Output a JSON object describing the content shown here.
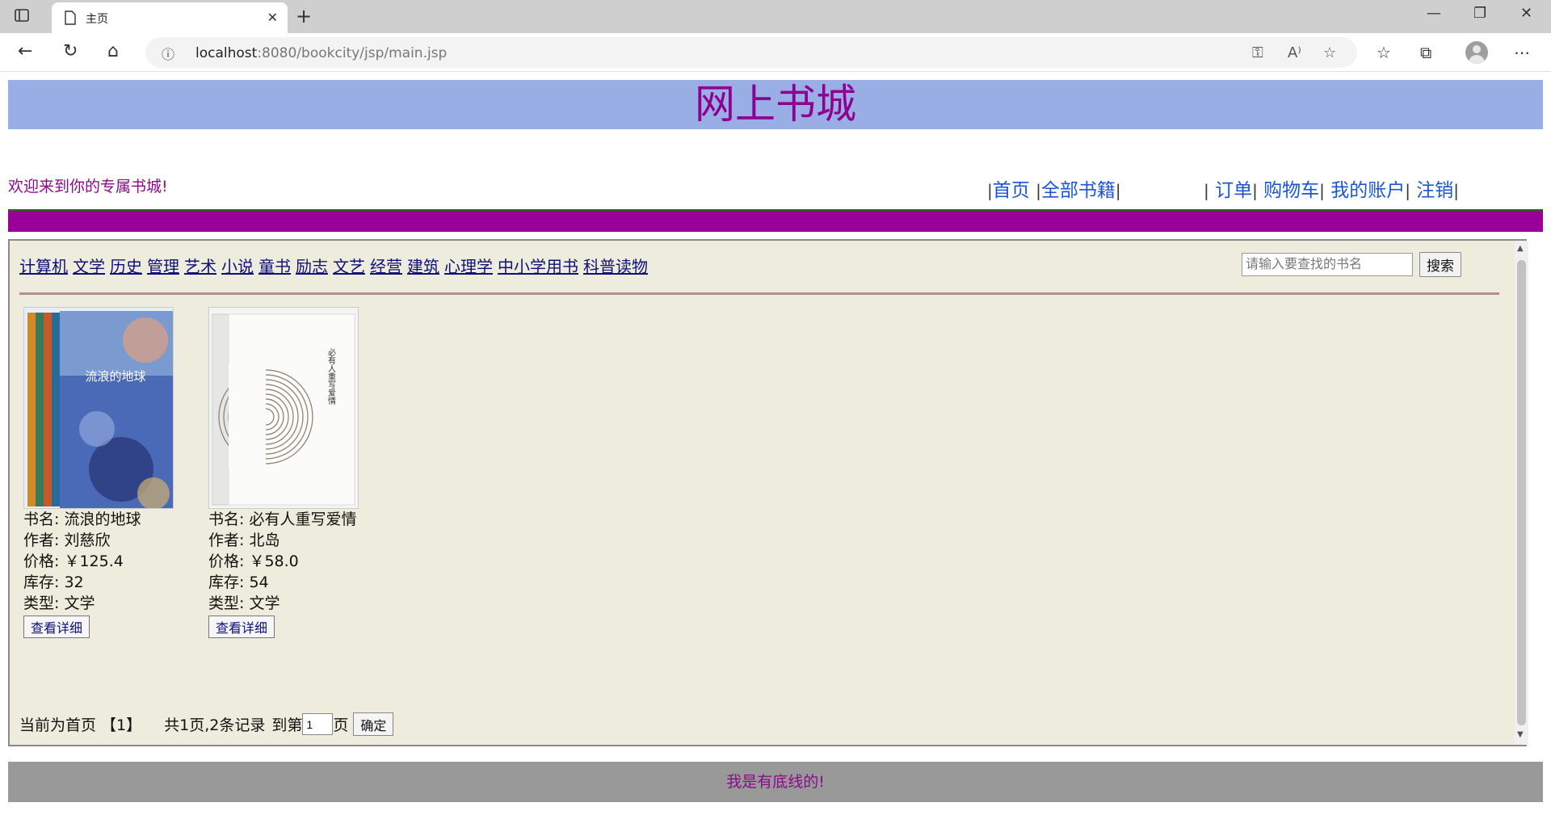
{
  "browser": {
    "tab_title": "主页",
    "url_host": "localhost",
    "url_rest": ":8080/bookcity/jsp/main.jsp"
  },
  "header": {
    "title": "网上书城"
  },
  "welcome": "欢迎来到你的专属书城!",
  "nav": {
    "home": "首页",
    "all_books": "全部书籍",
    "orders": "订单",
    "cart": "购物车",
    "account": "我的账户",
    "logout": "注销"
  },
  "categories": [
    "计算机",
    "文学",
    "历史",
    "管理",
    "艺术",
    "小说",
    "童书",
    "励志",
    "文艺",
    "经营",
    "建筑",
    "心理学",
    "中小学用书",
    "科普读物"
  ],
  "search": {
    "placeholder": "请输入要查找的书名",
    "button": "搜索"
  },
  "books": [
    {
      "name_line": "书名: 流浪的地球",
      "author_line": "作者: 刘慈欣",
      "price_line": "价格: ￥125.4",
      "stock_line": "库存: 32",
      "type_line": "类型: 文学",
      "detail": "查看详细",
      "cover_title": "流浪的地球"
    },
    {
      "name_line": "书名: 必有人重写爱情",
      "author_line": "作者: 北岛",
      "price_line": "价格: ￥58.0",
      "stock_line": "库存: 54",
      "type_line": "类型: 文学",
      "detail": "查看详细",
      "cover_title": "必有人重写爱情"
    }
  ],
  "pager": {
    "current": "当前为首页 【1】",
    "total": "共1页,2条记录",
    "goto_prefix": "到第",
    "page_value": "1",
    "goto_suffix": "页",
    "confirm": "确定"
  },
  "footer": "我是有底线的!",
  "colors": {
    "header_bg": "#9aaee6",
    "title": "#900090",
    "purple_bar": "#990099",
    "frame_bg": "#eeecdc",
    "footer_bg": "#999999"
  }
}
